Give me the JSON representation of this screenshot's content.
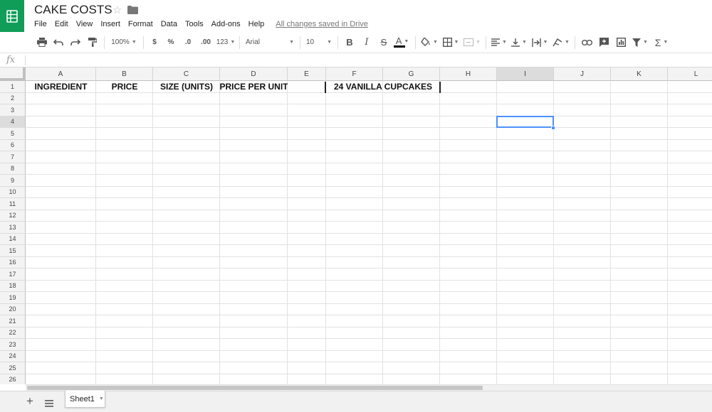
{
  "document": {
    "title": "CAKE COSTS",
    "save_status": "All changes saved in Drive"
  },
  "menu": [
    "File",
    "Edit",
    "View",
    "Insert",
    "Format",
    "Data",
    "Tools",
    "Add-ons",
    "Help"
  ],
  "toolbar": {
    "zoom": "100%",
    "currency": "$",
    "percent": "%",
    "decrease_decimals": ".0",
    "increase_decimals": ".00",
    "more_formats": "123",
    "font": "Arial",
    "font_size": "10",
    "bold": "B",
    "italic": "I",
    "strikethrough": "S",
    "text_color": "A",
    "text_color_bar": "#000000"
  },
  "formula_bar": {
    "fx_label": "fx",
    "value": ""
  },
  "grid": {
    "columns": [
      "A",
      "B",
      "C",
      "D",
      "E",
      "F",
      "G",
      "H",
      "I",
      "J",
      "K",
      "L"
    ],
    "rows": [
      "1",
      "2",
      "3",
      "4",
      "5",
      "6",
      "7",
      "8",
      "9",
      "10",
      "11",
      "12",
      "13",
      "14",
      "15",
      "16",
      "17",
      "18",
      "19",
      "20",
      "21",
      "22",
      "23",
      "24",
      "25",
      "26"
    ],
    "cells": {
      "A1": "INGREDIENT",
      "B1": "PRICE",
      "C1": "SIZE (UNITS)",
      "D1": "PRICE PER UNIT",
      "F1": "24 VANILLA CUPCAKES"
    },
    "active_cell": "I4",
    "selected_column": "I",
    "selected_row": "4"
  },
  "sheets": {
    "tabs": [
      "Sheet1"
    ],
    "active": "Sheet1"
  },
  "colors": {
    "brand_green": "#0f9d58",
    "selection_blue": "#4d90fe"
  }
}
